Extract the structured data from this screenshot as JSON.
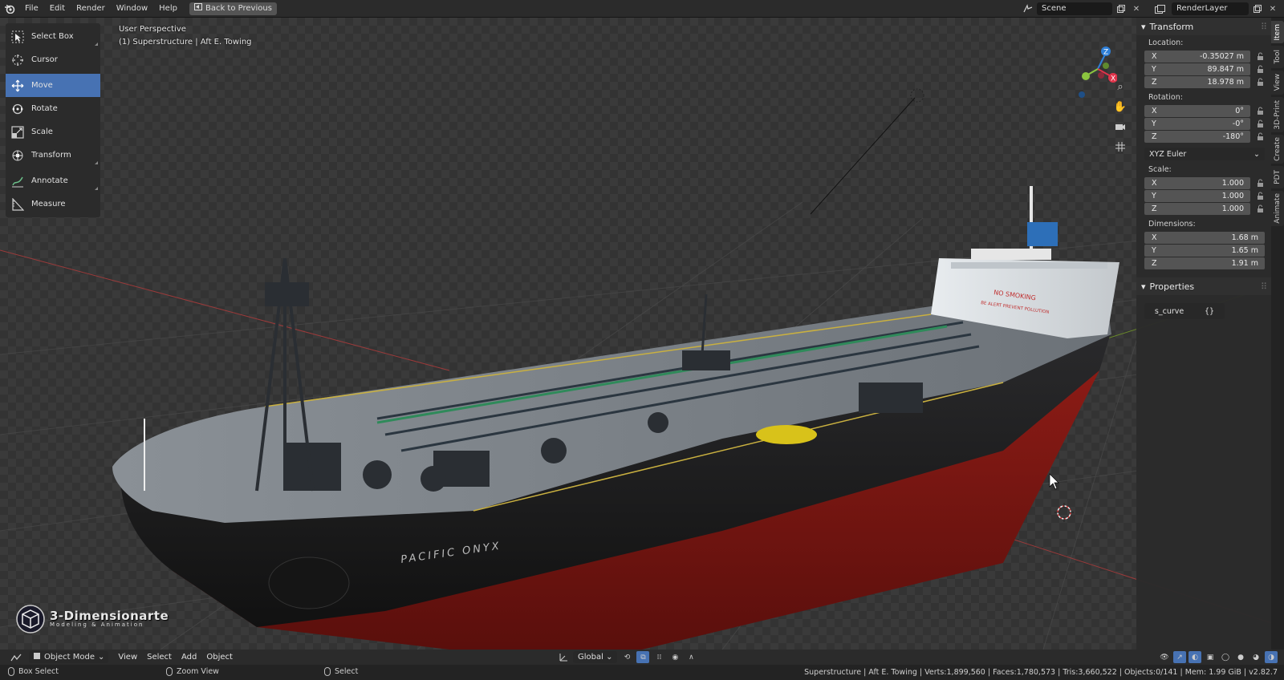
{
  "topbar": {
    "menus": [
      "File",
      "Edit",
      "Render",
      "Window",
      "Help"
    ],
    "back_button": "Back to Previous",
    "scene_name": "Scene",
    "render_layer": "RenderLayer"
  },
  "viewport": {
    "perspective_label": "User Perspective",
    "object_label": "(1) Superstructure | Aft E. Towing",
    "ship_name": "PACIFIC ONYX",
    "deck_sign_1": "NO SMOKING",
    "deck_sign_2": "BE ALERT PREVENT POLLUTION"
  },
  "toolbar": {
    "tools": [
      {
        "label": "Select Box",
        "icon": "select-box-icon"
      },
      {
        "label": "Cursor",
        "icon": "cursor-icon"
      },
      {
        "label": "Move",
        "icon": "move-icon",
        "active": true
      },
      {
        "label": "Rotate",
        "icon": "rotate-icon"
      },
      {
        "label": "Scale",
        "icon": "scale-icon"
      },
      {
        "label": "Transform",
        "icon": "transform-icon"
      },
      {
        "label": "Annotate",
        "icon": "annotate-icon"
      },
      {
        "label": "Measure",
        "icon": "measure-icon"
      }
    ]
  },
  "gizmo": {
    "z": "Z",
    "x": "X",
    "colors": {
      "x": "#e0334a",
      "y": "#8bc53f",
      "z": "#2e7fd8"
    }
  },
  "npanel": {
    "transform_title": "Transform",
    "location_label": "Location:",
    "location": {
      "x": "-0.35027 m",
      "y": "89.847 m",
      "z": "18.978 m"
    },
    "rotation_label": "Rotation:",
    "rotation": {
      "x": "0°",
      "y": "-0°",
      "z": "-180°"
    },
    "rotation_mode": "XYZ Euler",
    "scale_label": "Scale:",
    "scale": {
      "x": "1.000",
      "y": "1.000",
      "z": "1.000"
    },
    "dimensions_label": "Dimensions:",
    "dimensions": {
      "x": "1.68 m",
      "y": "1.65 m",
      "z": "1.91 m"
    },
    "axis_labels": {
      "x": "X",
      "y": "Y",
      "z": "Z"
    },
    "properties_title": "Properties",
    "custom_prop_name": "s_curve",
    "custom_prop_value": "{}"
  },
  "vtabs": [
    "Item",
    "Tool",
    "View",
    "3D-Print",
    "Create",
    "PDT",
    "Animate"
  ],
  "header": {
    "mode": "Object Mode",
    "menus": [
      "View",
      "Select",
      "Add",
      "Object"
    ],
    "orientation": "Global"
  },
  "statusbar": {
    "left_action": "Box Select",
    "middle_action": "Zoom View",
    "right_action": "Select",
    "stats": "Superstructure | Aft E. Towing | Verts:1,899,560 | Faces:1,780,573 | Tris:3,660,522 | Objects:0/141 | Mem: 1.99 GiB | v2.82.7"
  },
  "watermark": {
    "title": "3-Dimensionarte",
    "subtitle": "Modeling & Animation"
  },
  "colors": {
    "accent": "#4772b3",
    "hull_red": "#8a1a14",
    "hull_black": "#1c1c1e",
    "deck": "#7d8388"
  }
}
